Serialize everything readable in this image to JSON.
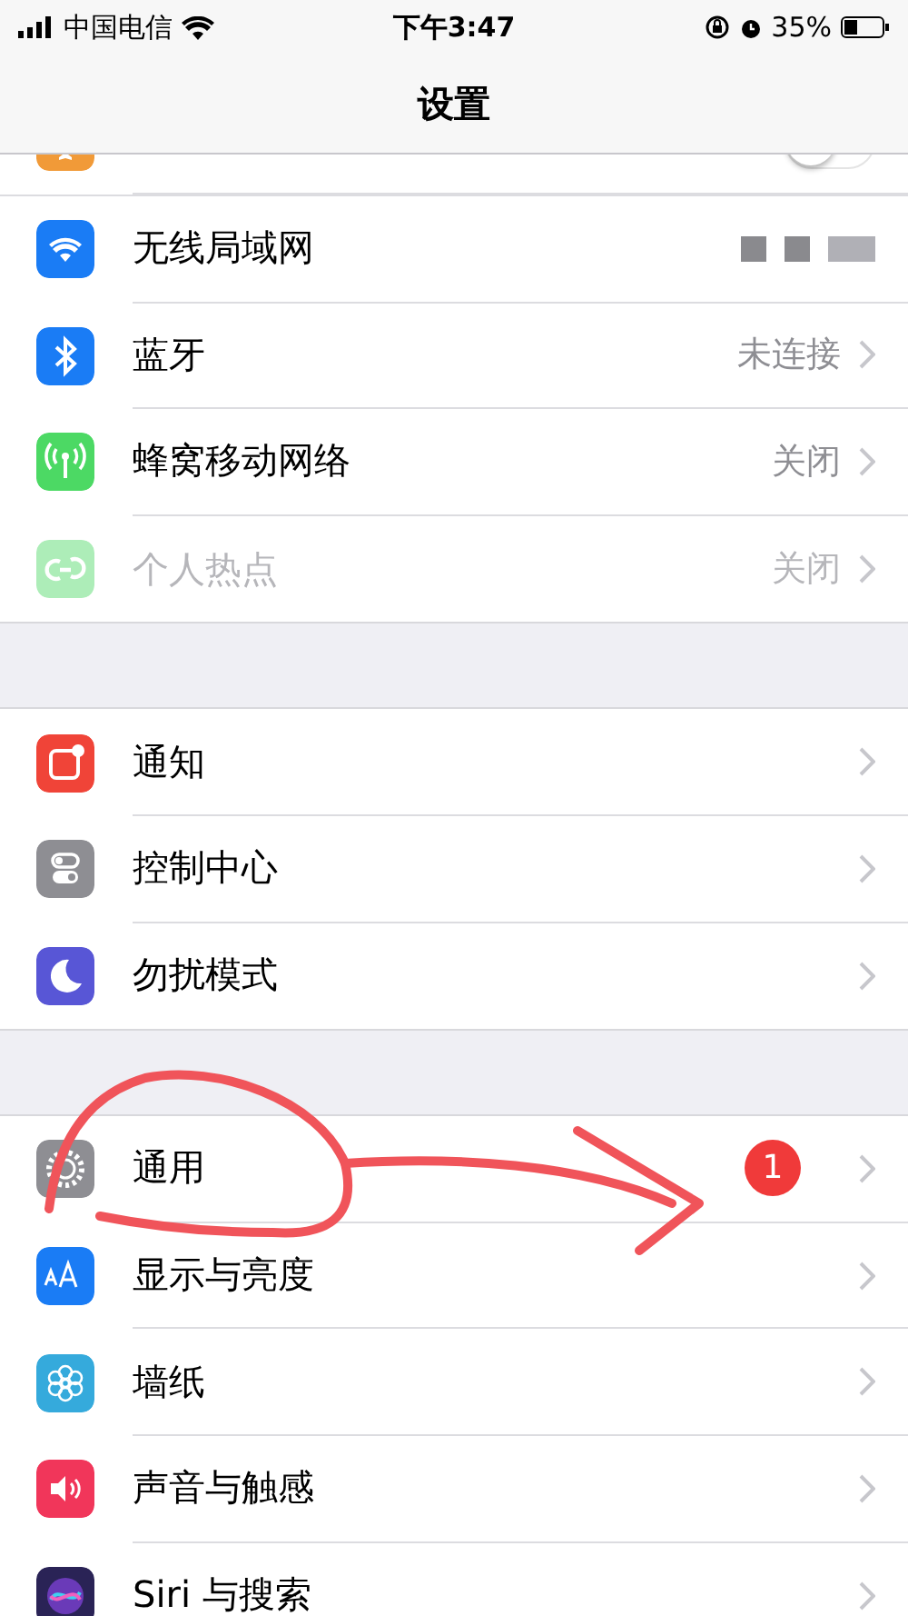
{
  "status_bar": {
    "carrier": "中国电信",
    "time": "下午3:47",
    "battery": "35%"
  },
  "nav": {
    "title": "设置"
  },
  "groups": [
    {
      "rows": [
        {
          "kind": "toggle",
          "on": false,
          "disabled": false
        },
        {
          "kind": "masked",
          "label": "无线局域网",
          "disabled": false
        },
        {
          "kind": "disclosure",
          "label": "蓝牙",
          "value": "未连接",
          "disabled": false
        },
        {
          "kind": "disclosure",
          "label": "蜂窝移动网络",
          "value": "关闭",
          "disabled": false
        },
        {
          "kind": "disclosure",
          "label": "个人热点",
          "value": "关闭",
          "disabled": true
        }
      ]
    },
    {
      "rows": [
        {
          "kind": "disclosure",
          "label": "通知",
          "disabled": false
        },
        {
          "kind": "disclosure",
          "label": "控制中心",
          "disabled": false
        },
        {
          "kind": "disclosure",
          "label": "勿扰模式",
          "disabled": false
        }
      ]
    },
    {
      "rows": [
        {
          "kind": "disclosure",
          "label": "通用",
          "badge": "1",
          "disabled": false
        },
        {
          "kind": "disclosure",
          "label": "显示与亮度",
          "disabled": false
        },
        {
          "kind": "disclosure",
          "label": "墙纸",
          "disabled": false
        },
        {
          "kind": "disclosure",
          "label": "声音与触感",
          "disabled": false
        },
        {
          "kind": "disclosure",
          "label": "Siri 与搜索",
          "disabled": false
        }
      ]
    }
  ]
}
